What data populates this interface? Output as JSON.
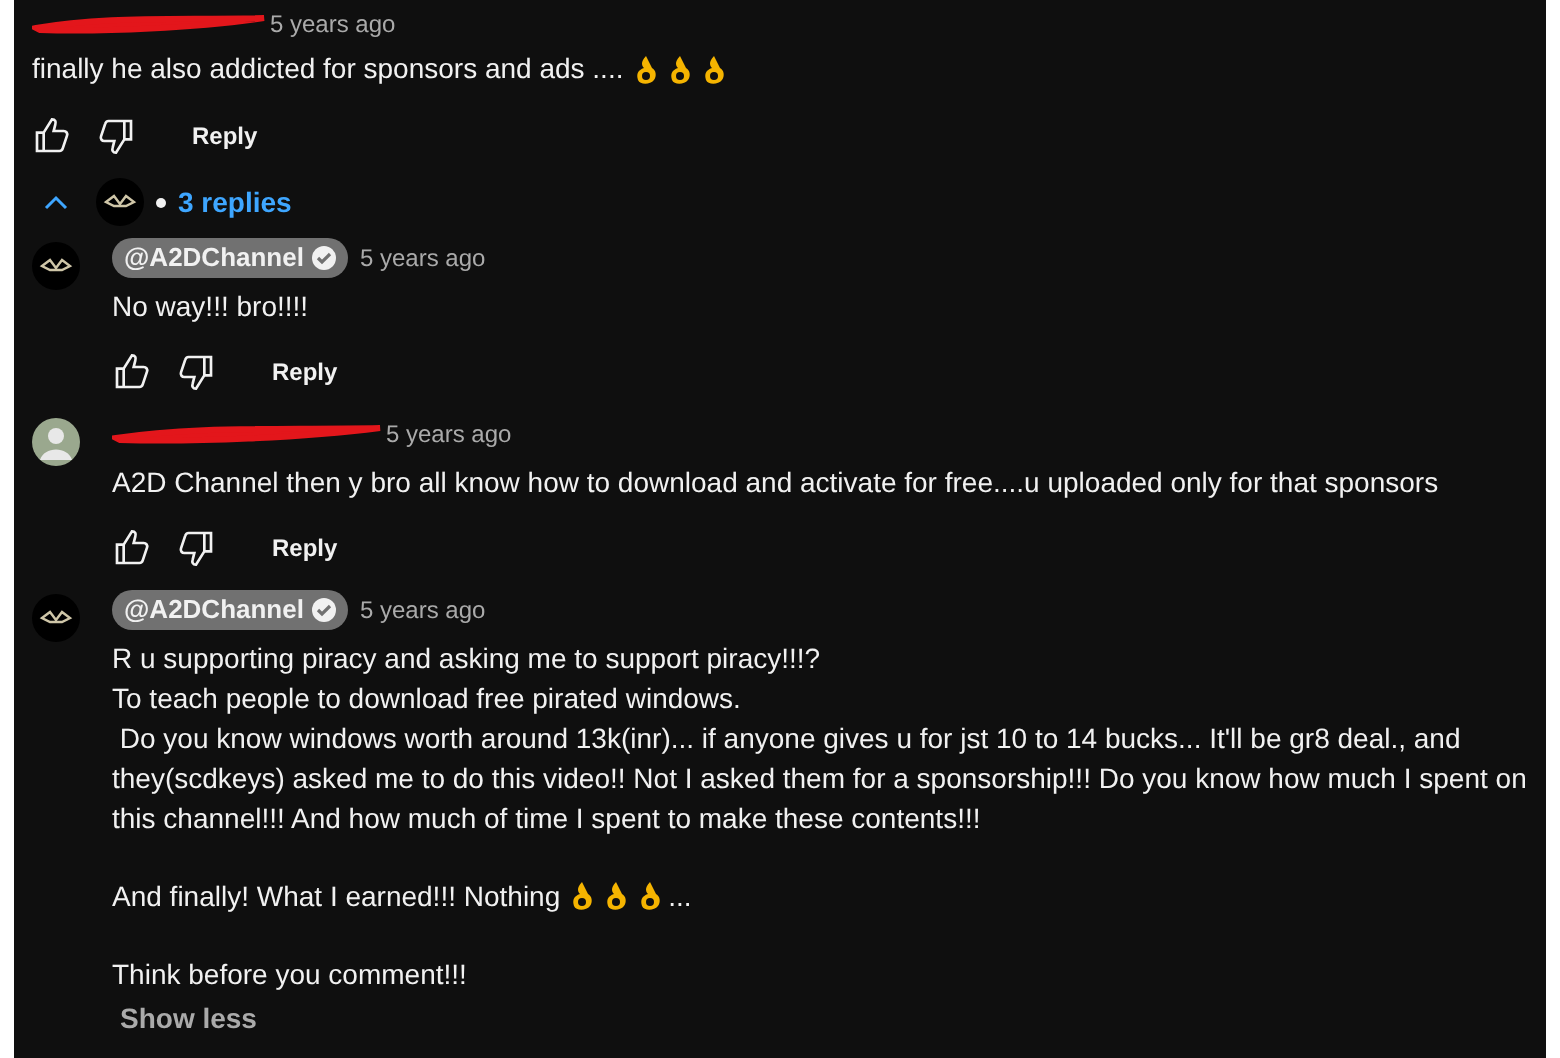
{
  "comment": {
    "author_redacted": true,
    "time": "5 years ago",
    "text": "finally he also addicted for sponsors and ads ....",
    "emojis": [
      {
        "kind": "ok-hand"
      },
      {
        "kind": "ok-hand"
      },
      {
        "kind": "ok-hand"
      }
    ],
    "reply_label": "Reply"
  },
  "replies_toggle": {
    "expanded": true,
    "label": "3 replies"
  },
  "replies": [
    {
      "author": "@A2DChannel",
      "author_redacted": false,
      "verified": true,
      "avatar": {
        "kind": "logo"
      },
      "time": "5 years ago",
      "paragraphs": [
        {
          "text": "No way!!! bro!!!!"
        }
      ],
      "reply_label": "Reply"
    },
    {
      "author_redacted": true,
      "verified": false,
      "avatar": {
        "kind": "photo"
      },
      "time": "5 years ago",
      "paragraphs": [
        {
          "text": "A2D Channel then y bro all know how to download and activate for free....u uploaded only for that sponsors"
        }
      ],
      "reply_label": "Reply"
    },
    {
      "author": "@A2DChannel",
      "author_redacted": false,
      "verified": true,
      "avatar": {
        "kind": "logo"
      },
      "time": "5 years ago",
      "paragraphs": [
        {
          "text": "R u supporting piracy and asking me to support piracy!!!?\nTo teach people to download free pirated windows.\n Do you know windows worth around 13k(inr)... if anyone gives u for jst 10 to 14 bucks... It'll be gr8 deal., and they(scdkeys) asked me to do this video!! Not I asked them for a sponsorship!!! Do you know how much I spent on this channel!!! And how much of time I spent to make these contents!!!"
        },
        {
          "text": "And finally! What I earned!!! Nothing",
          "emojis": [
            {
              "kind": "ok-hand"
            },
            {
              "kind": "ok-hand"
            },
            {
              "kind": "ok-hand"
            }
          ],
          "suffix": "..."
        },
        {
          "text": "Think before you comment!!!"
        }
      ],
      "show_less": "Show less"
    }
  ]
}
